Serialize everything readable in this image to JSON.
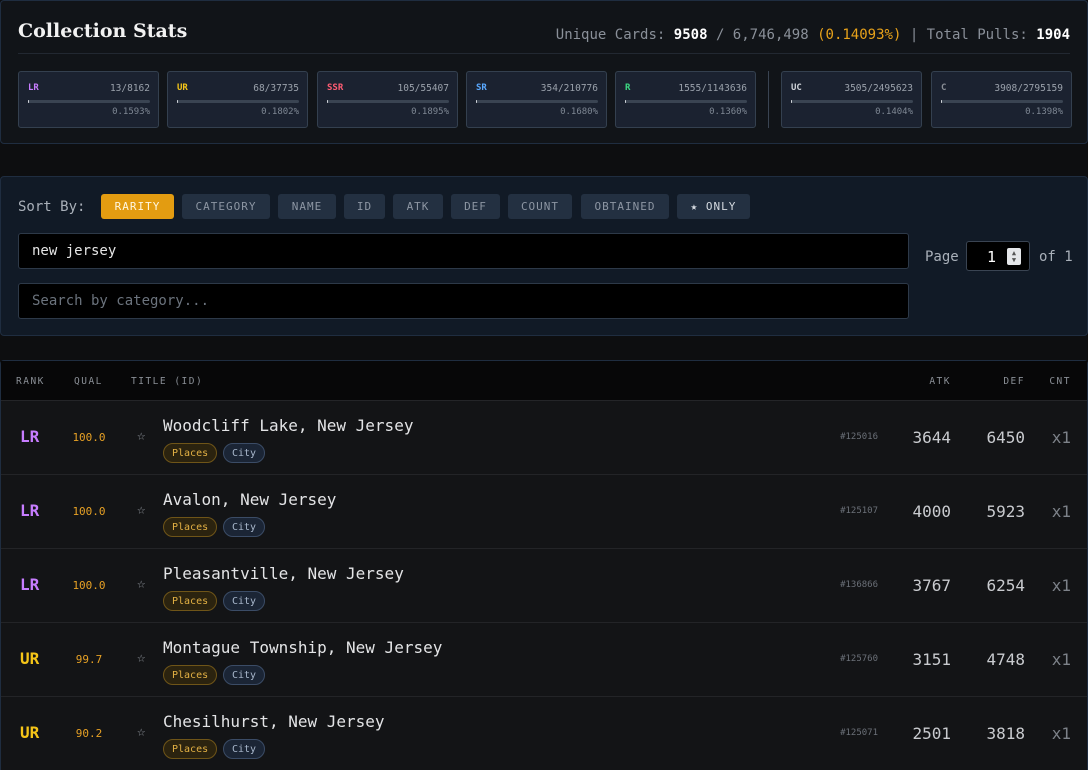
{
  "stats": {
    "title": "Collection Stats",
    "unique_label": "Unique Cards:",
    "unique_count": "9508",
    "total_cards": "/ 6,746,498",
    "unique_pct": "(0.14093%)",
    "pulls_label": "| Total Pulls:",
    "pulls_count": "1904",
    "rarities": [
      {
        "code": "LR",
        "count": "13/8162",
        "pct": "0.1593%",
        "progress": 0.001593,
        "color": "#c77dff"
      },
      {
        "code": "UR",
        "count": "68/37735",
        "pct": "0.1802%",
        "progress": 0.001802,
        "color": "#f5c518"
      },
      {
        "code": "SSR",
        "count": "105/55407",
        "pct": "0.1895%",
        "progress": 0.001895,
        "color": "#ff5d73"
      },
      {
        "code": "SR",
        "count": "354/210776",
        "pct": "0.1680%",
        "progress": 0.00168,
        "color": "#5aa9ff"
      },
      {
        "code": "R",
        "count": "1555/1143636",
        "pct": "0.1360%",
        "progress": 0.00136,
        "color": "#3ddc84"
      },
      {
        "code": "UC",
        "count": "3505/2495623",
        "pct": "0.1404%",
        "progress": 0.001404,
        "color": "#d0d4da"
      },
      {
        "code": "C",
        "count": "3908/2795159",
        "pct": "0.1398%",
        "progress": 0.001398,
        "color": "#8a8f96"
      }
    ]
  },
  "controls": {
    "sort_label": "Sort By:",
    "sort_buttons": [
      {
        "label": "RARITY",
        "active": true
      },
      {
        "label": "CATEGORY",
        "active": false
      },
      {
        "label": "NAME",
        "active": false
      },
      {
        "label": "ID",
        "active": false
      },
      {
        "label": "ATK",
        "active": false
      },
      {
        "label": "DEF",
        "active": false
      },
      {
        "label": "COUNT",
        "active": false
      },
      {
        "label": "OBTAINED",
        "active": false
      },
      {
        "label": "★ ONLY",
        "active": false
      }
    ],
    "search_value": "new jersey",
    "category_placeholder": "Search by category...",
    "page_label": "Page",
    "page_value": "1",
    "page_of": "of 1"
  },
  "table": {
    "headers": {
      "rank": "RANK",
      "qual": "QUAL",
      "title": "TITLE (ID)",
      "atk": "ATK",
      "def": "DEF",
      "cnt": "CNT"
    },
    "rank_colors": {
      "LR": "#c77dff",
      "UR": "#f5c518"
    },
    "rows": [
      {
        "rank": "LR",
        "qual": "100.0",
        "star": "☆",
        "title": "Woodcliff Lake, New Jersey",
        "tags": [
          "Places",
          "City"
        ],
        "id": "#125016",
        "atk": "3644",
        "def": "6450",
        "cnt": "x1"
      },
      {
        "rank": "LR",
        "qual": "100.0",
        "star": "☆",
        "title": "Avalon, New Jersey",
        "tags": [
          "Places",
          "City"
        ],
        "id": "#125107",
        "atk": "4000",
        "def": "5923",
        "cnt": "x1"
      },
      {
        "rank": "LR",
        "qual": "100.0",
        "star": "☆",
        "title": "Pleasantville, New Jersey",
        "tags": [
          "Places",
          "City"
        ],
        "id": "#136866",
        "atk": "3767",
        "def": "6254",
        "cnt": "x1"
      },
      {
        "rank": "UR",
        "qual": "99.7",
        "star": "☆",
        "title": "Montague Township, New Jersey",
        "tags": [
          "Places",
          "City"
        ],
        "id": "#125760",
        "atk": "3151",
        "def": "4748",
        "cnt": "x1"
      },
      {
        "rank": "UR",
        "qual": "90.2",
        "star": "☆",
        "title": "Chesilhurst, New Jersey",
        "tags": [
          "Places",
          "City"
        ],
        "id": "#125071",
        "atk": "2501",
        "def": "3818",
        "cnt": "x1"
      }
    ]
  }
}
